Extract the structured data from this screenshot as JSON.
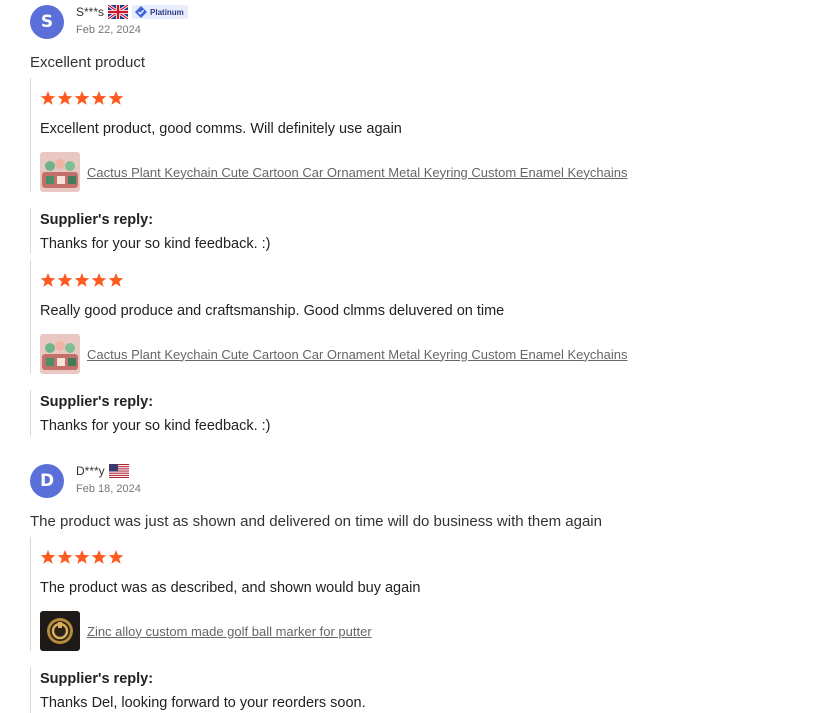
{
  "colors": {
    "avatar_bg": "#5b6fd8",
    "star": "#ff5a1f",
    "link": "#666666",
    "divider": "#d8d8d8"
  },
  "reviews": [
    {
      "avatar_letter": "S",
      "user_name": "S***s",
      "flag_icon": "uk-flag-icon",
      "badge_label": "Platinum",
      "date": "Feb 22, 2024",
      "summary": "Excellent product",
      "entries": [
        {
          "rating": 5,
          "comment": "Excellent product, good comms. Will definitely use again",
          "product_title": "Cactus Plant Keychain Cute Cartoon Car Ornament Metal Keyring Custom Enamel Keychains",
          "reply_title": "Supplier's reply:",
          "reply_text": "Thanks for your so kind feedback. :)"
        },
        {
          "rating": 5,
          "comment": "Really good produce and craftsmanship. Good clmms deluvered on time",
          "product_title": "Cactus Plant Keychain Cute Cartoon Car Ornament Metal Keyring Custom Enamel Keychains",
          "reply_title": "Supplier's reply:",
          "reply_text": "Thanks for your so kind feedback. :)"
        }
      ]
    },
    {
      "avatar_letter": "D",
      "user_name": "D***y",
      "flag_icon": "us-flag-icon",
      "date": "Feb 18, 2024",
      "summary": "The product was just as shown and delivered on time will do business with them again",
      "entries": [
        {
          "rating": 5,
          "comment": "The product was as described, and shown would buy again",
          "product_title": "Zinc alloy custom made golf ball marker for putter",
          "reply_title": "Supplier's reply:",
          "reply_text": "Thanks Del, looking forward to your reorders soon."
        }
      ]
    }
  ]
}
